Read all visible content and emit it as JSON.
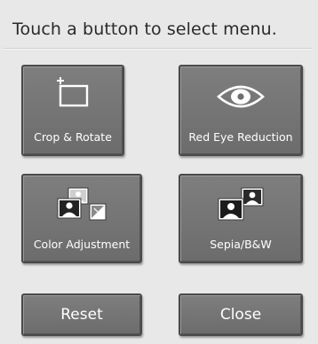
{
  "header": {
    "instruction": "Touch a button to select menu."
  },
  "menu": {
    "crop_rotate": {
      "label": "Crop & Rotate",
      "icon": "crop-icon"
    },
    "red_eye": {
      "label": "Red Eye Reduction",
      "icon": "eye-icon"
    },
    "color_adjust": {
      "label": "Color Adjustment",
      "icon": "color-adjust-icon"
    },
    "sepia_bw": {
      "label": "Sepia/B&W",
      "icon": "sepia-icon"
    }
  },
  "actions": {
    "reset_label": "Reset",
    "close_label": "Close"
  }
}
